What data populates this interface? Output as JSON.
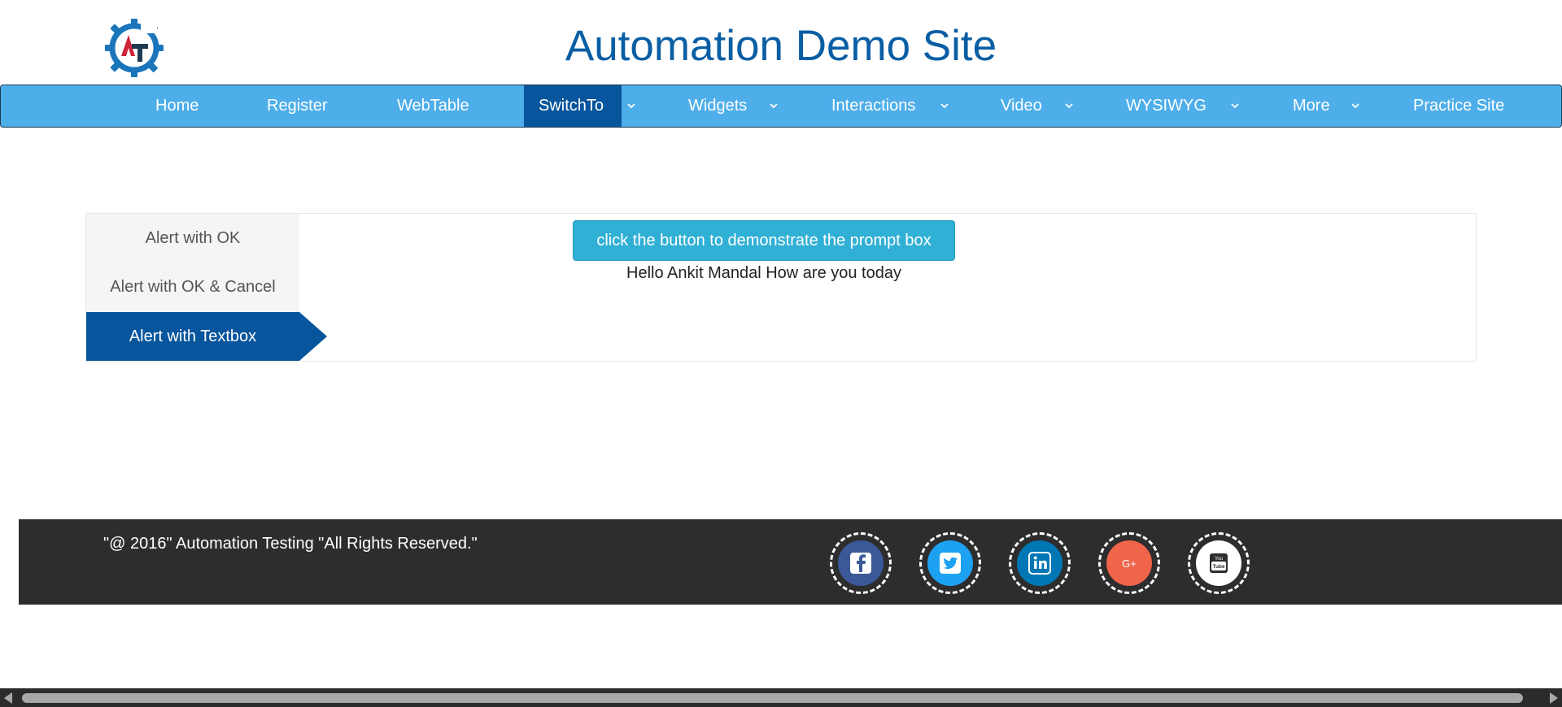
{
  "header": {
    "title": "Automation Demo Site",
    "logo_icon": "gear-logo-icon",
    "colors": {
      "title": "#0a5ea4",
      "logo_gear": "#1a75bb",
      "logo_a": "#d0243b",
      "logo_t": "#1f3b52"
    }
  },
  "nav": {
    "items": [
      {
        "label": "Home",
        "dropdown": false,
        "active": false
      },
      {
        "label": "Register",
        "dropdown": false,
        "active": false
      },
      {
        "label": "WebTable",
        "dropdown": false,
        "active": false
      },
      {
        "label": "SwitchTo",
        "dropdown": true,
        "active": true
      },
      {
        "label": "Widgets",
        "dropdown": true,
        "active": false
      },
      {
        "label": "Interactions",
        "dropdown": true,
        "active": false
      },
      {
        "label": "Video",
        "dropdown": true,
        "active": false
      },
      {
        "label": "WYSIWYG",
        "dropdown": true,
        "active": false
      },
      {
        "label": "More",
        "dropdown": true,
        "active": false
      },
      {
        "label": "Practice Site",
        "dropdown": false,
        "active": false
      }
    ],
    "colors": {
      "bar": "#4eaeea",
      "active": "#07559c"
    }
  },
  "tabs": {
    "items": [
      {
        "label": "Alert with OK",
        "active": false
      },
      {
        "label": "Alert with OK & Cancel",
        "active": false
      },
      {
        "label": "Alert with Textbox",
        "active": true
      }
    ]
  },
  "content": {
    "button_label": "click the button to demonstrate the prompt box",
    "result_text": "Hello Ankit Mandal How are you today"
  },
  "footer": {
    "copyright": "\"@ 2016\" Automation Testing \"All Rights Reserved.\"",
    "social": [
      {
        "icon": "facebook-icon",
        "color": "#3b5998"
      },
      {
        "icon": "twitter-icon",
        "color": "#1da1f2"
      },
      {
        "icon": "linkedin-icon",
        "color": "#0077b5"
      },
      {
        "icon": "google-plus-icon",
        "color": "#dd4b39"
      },
      {
        "icon": "youtube-icon",
        "color": "#ffffff"
      }
    ]
  }
}
